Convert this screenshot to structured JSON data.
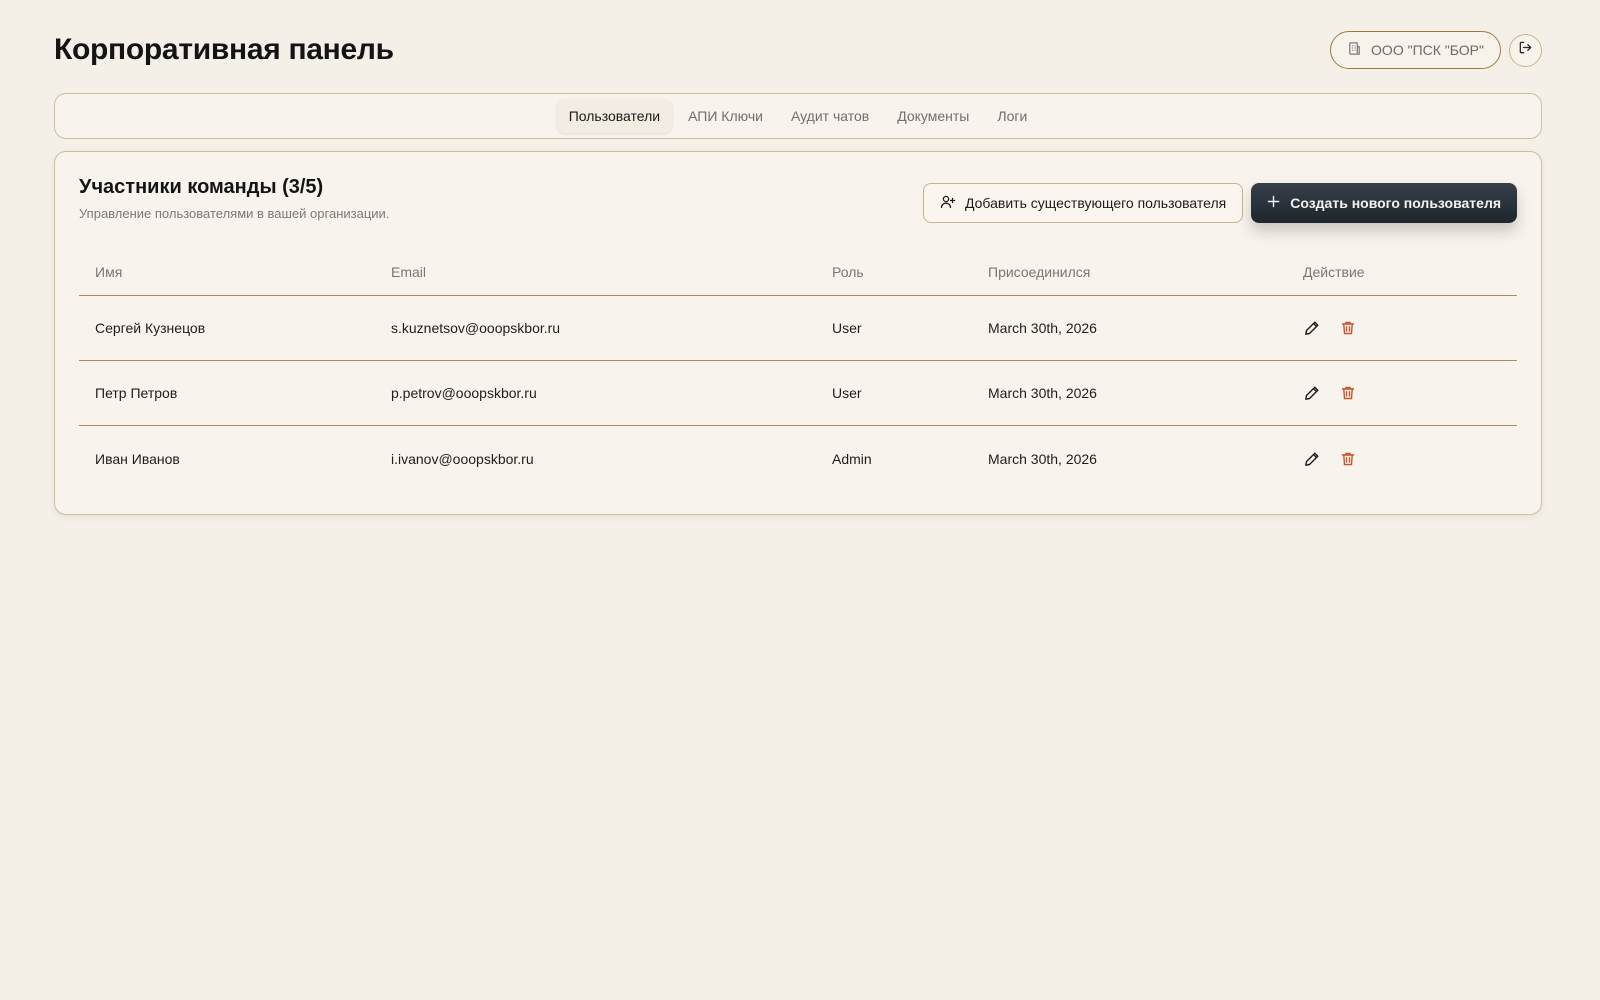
{
  "header": {
    "title": "Корпоративная панель",
    "org_name": "ООО \"ПСК \"БОР\"",
    "org_icon": "building-icon",
    "logout_icon": "logout-icon"
  },
  "tabs": [
    {
      "label": "Пользователи",
      "active": true
    },
    {
      "label": "АПИ Ключи",
      "active": false
    },
    {
      "label": "Аудит чатов",
      "active": false
    },
    {
      "label": "Документы",
      "active": false
    },
    {
      "label": "Логи",
      "active": false
    }
  ],
  "team": {
    "title": "Участники команды (3/5)",
    "subtitle": "Управление пользователями в вашей организации.",
    "add_existing_label": "Добавить существующего пользователя",
    "create_new_label": "Создать нового пользователя"
  },
  "table": {
    "columns": [
      "Имя",
      "Email",
      "Роль",
      "Присоединился",
      "Действие"
    ],
    "rows": [
      {
        "name": "Сергей Кузнецов",
        "email": "s.kuznetsov@ooopskbor.ru",
        "role": "User",
        "joined": "March 30th, 2026"
      },
      {
        "name": "Петр Петров",
        "email": "p.petrov@ooopskbor.ru",
        "role": "User",
        "joined": "March 30th, 2026"
      },
      {
        "name": "Иван Иванов",
        "email": "i.ivanov@ooopskbor.ru",
        "role": "Admin",
        "joined": "March 30th, 2026"
      }
    ]
  },
  "colors": {
    "background": "#f4efe7",
    "border": "#cdbf9c",
    "delete": "#c4532e",
    "primary_button": "#262e35"
  }
}
